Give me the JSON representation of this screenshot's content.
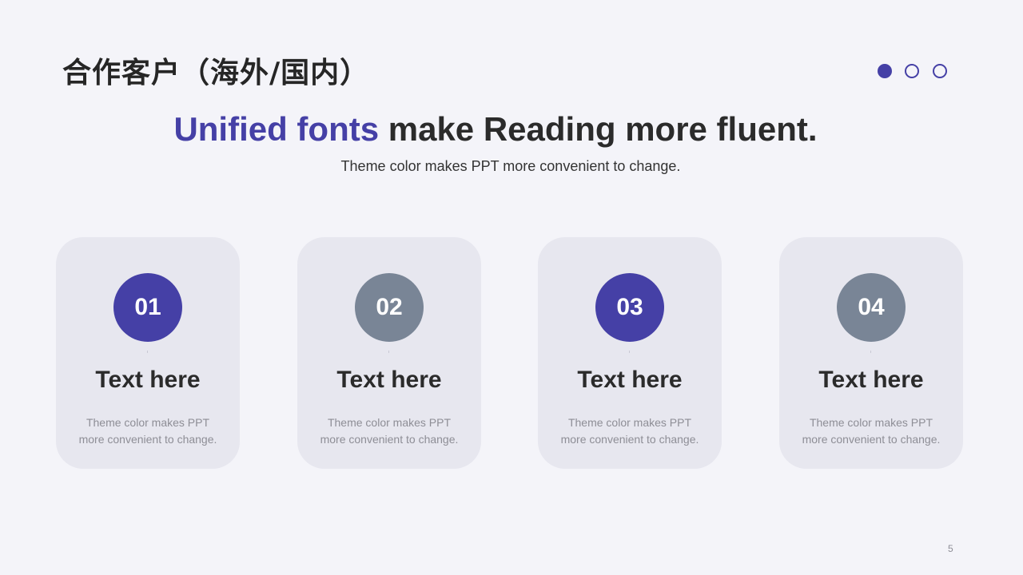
{
  "slide": {
    "title": "合作客户（海外/国内）",
    "headline_accent": "Unified fonts",
    "headline_rest": " make Reading more fluent.",
    "subheadline": "Theme color makes PPT more convenient to change.",
    "pager": {
      "count": 3,
      "active_index": 0,
      "active_color": "#4540a6"
    },
    "cards": [
      {
        "number": "01",
        "title": "Text here",
        "desc_line1": "Theme color makes PPT",
        "desc_line2": "more convenient to change.",
        "circle_color": "#4540a6"
      },
      {
        "number": "02",
        "title": "Text here",
        "desc_line1": "Theme color makes PPT",
        "desc_line2": "more convenient to change.",
        "circle_color": "#798596"
      },
      {
        "number": "03",
        "title": "Text here",
        "desc_line1": "Theme color makes PPT",
        "desc_line2": "more convenient to change.",
        "circle_color": "#4540a6"
      },
      {
        "number": "04",
        "title": "Text here",
        "desc_line1": "Theme color makes PPT",
        "desc_line2": "more convenient to change.",
        "circle_color": "#798596"
      }
    ],
    "page_number": "5",
    "colors": {
      "background": "#f4f4f9",
      "card": "#e7e7ef",
      "accent": "#4540a6",
      "secondary": "#798596",
      "text": "#2b2b2b"
    }
  }
}
